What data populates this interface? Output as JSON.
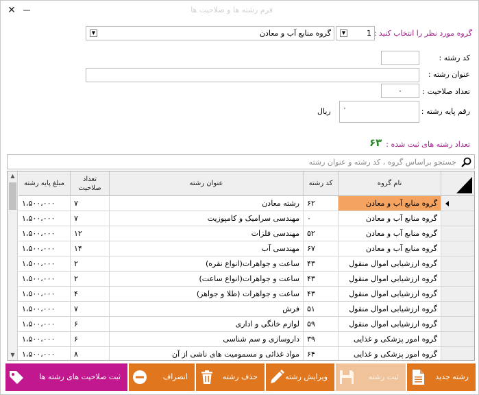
{
  "window": {
    "title": "فرم رشته ها و صلاحیت ها",
    "close_glyph": "✕",
    "minimize_glyph": "—"
  },
  "form": {
    "group_label": "گروه مورد نظر را انتخاب کنید :",
    "group_code": "1",
    "group_name": "گروه منابع آب و معادن",
    "code_label": "کد رشته :",
    "code_value": "",
    "title_label": "عنوان رشته :",
    "title_value": "",
    "competency_count_label": "تعداد صلاحیت :",
    "competency_count_value": "۰",
    "base_amount_label": "رقم پایه رشته :",
    "base_amount_value": "۰",
    "currency": "ریال",
    "registered_label": "تعداد رشته های ثبت شده :",
    "registered_count": "۶۳"
  },
  "search": {
    "placeholder": "جستجو براساس گروه ، کد رشته و عنوان رشته"
  },
  "table": {
    "headers": {
      "group": "نام گروه",
      "code": "کد رشته",
      "title": "عنوان رشته",
      "count": "تعداد صلاحیت",
      "amount": "مبلغ پایه رشته"
    },
    "rows": [
      {
        "group": "گروه منابع آب و معادن",
        "code": "۶۲",
        "title": "رشته معادن",
        "count": "۷",
        "amount": "۱،۵۰۰،۰۰۰"
      },
      {
        "group": "گروه منابع آب و معادن",
        "code": "۰",
        "title": "مهندسی سرامیک و کامپوزیت",
        "count": "۷",
        "amount": "۱،۵۰۰،۰۰۰"
      },
      {
        "group": "گروه منابع آب و معادن",
        "code": "۵۲",
        "title": "مهندسی فلزات",
        "count": "۱۲",
        "amount": "۱،۵۰۰،۰۰۰"
      },
      {
        "group": "گروه منابع آب و معادن",
        "code": "۶۷",
        "title": "مهندسی آب",
        "count": "۱۴",
        "amount": "۱،۵۰۰،۰۰۰"
      },
      {
        "group": "گروه ارزشیابی اموال منقول",
        "code": "۴۳",
        "title": "ساعت و جواهرات(انواع نقره)",
        "count": "۲",
        "amount": "۱،۵۰۰،۰۰۰"
      },
      {
        "group": "گروه ارزشیابی اموال منقول",
        "code": "۴۳",
        "title": "ساعت و جواهرات(انواع ساعت)",
        "count": "۲",
        "amount": "۱،۵۰۰،۰۰۰"
      },
      {
        "group": "گروه ارزشیابی اموال منقول",
        "code": "۴۳",
        "title": "ساعت و جواهرات (طلا و جواهر)",
        "count": "۴",
        "amount": "۱،۵۰۰،۰۰۰"
      },
      {
        "group": "گروه ارزشیابی اموال منقول",
        "code": "۵۱",
        "title": "فرش",
        "count": "۷",
        "amount": "۱،۵۰۰،۰۰۰"
      },
      {
        "group": "گروه ارزشیابی اموال منقول",
        "code": "۵۹",
        "title": "لوازم خانگی و اداری",
        "count": "۶",
        "amount": "۱،۵۰۰،۰۰۰"
      },
      {
        "group": "گروه امور پزشکی و غذایی",
        "code": "۳۹",
        "title": "داروسازی و سم شناسی",
        "count": "۶",
        "amount": "۱،۵۰۰،۰۰۰"
      },
      {
        "group": "گروه امور پزشکی و غذایی",
        "code": "۶۴",
        "title": "مواد غذائی و مسمومیت های ناشی از آن",
        "count": "۸",
        "amount": "۱،۵۰۰،۰۰۰"
      }
    ]
  },
  "toolbar": {
    "new": "رشته جدید",
    "save": "ثبت رشته",
    "edit": "ویرایش رشته",
    "delete": "حذف رشته",
    "cancel": "انصراف",
    "save_competencies": "ثبت صلاحیت های رشته ها"
  },
  "colors": {
    "accent_orange": "#e0761e",
    "accent_magenta": "#c2188f",
    "selected_cell": "#f4a460",
    "label_purple": "#a0208a",
    "count_green": "#2a8a2a"
  },
  "icons": [
    "close-icon",
    "minimize-icon",
    "search-icon",
    "new-document-icon",
    "save-icon",
    "edit-pencil-icon",
    "trash-icon",
    "cancel-minus-icon",
    "tag-icon",
    "row-pointer-icon"
  ]
}
